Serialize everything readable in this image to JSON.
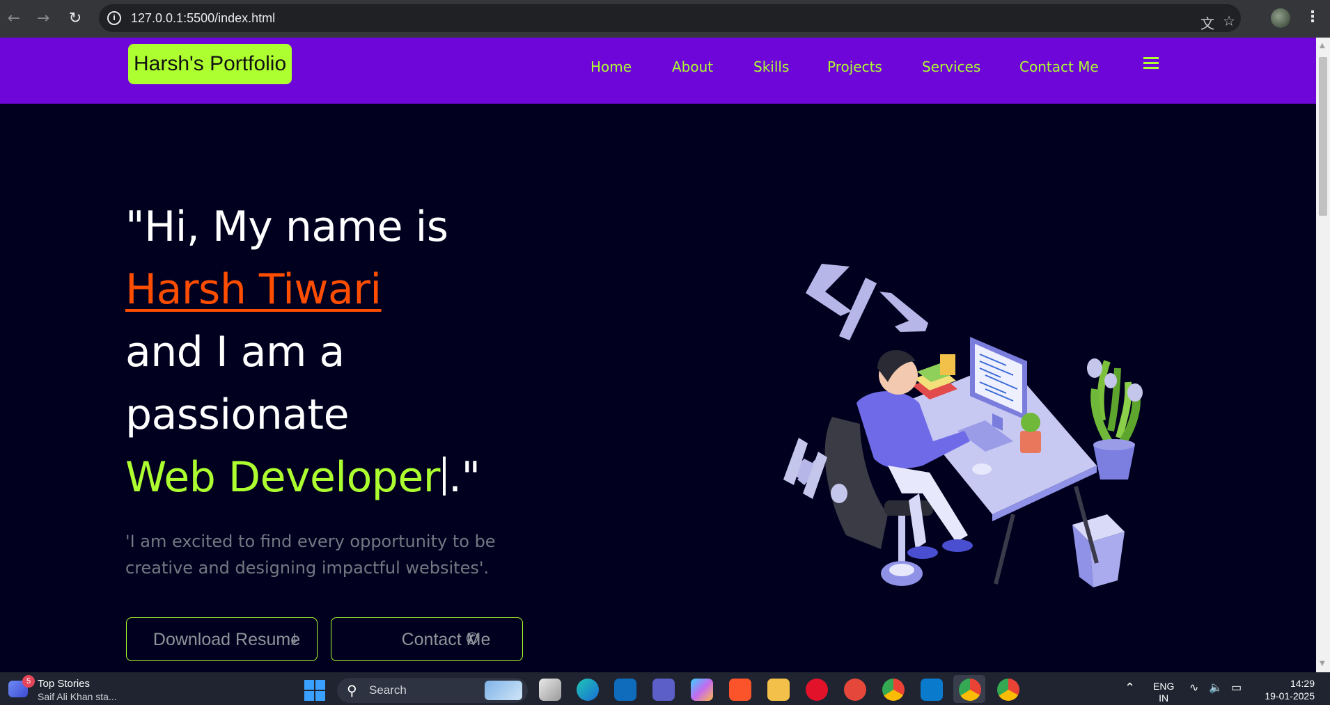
{
  "browser": {
    "url": "127.0.0.1:5500/index.html"
  },
  "nav": {
    "brand": "Harsh's Portfolio",
    "links": [
      "Home",
      "About",
      "Skills",
      "Projects",
      "Services",
      "Contact Me"
    ]
  },
  "hero": {
    "line1": "\"Hi, My name is",
    "name": "Harsh Tiwari",
    "line3": "and I am a",
    "line4": "passionate",
    "role": "Web Developer",
    "closing": ".\"",
    "tagline": "'I am excited to find every opportunity to be creative and designing impactful websites'.",
    "buttons": {
      "resume": "Download Resume",
      "contact": "Contact Me"
    }
  },
  "taskbar": {
    "widget_badge": "5",
    "widget_title": "Top Stories",
    "widget_subtitle": "Saif Ali Khan sta...",
    "search_label": "Search",
    "language_line1": "ENG",
    "language_line2": "IN",
    "time": "14:29",
    "date": "19-01-2025"
  },
  "colors": {
    "nav_bg": "#6e06d9",
    "accent": "#adff2f",
    "name_color": "#ff4d00",
    "hero_bg": "#01011f"
  }
}
